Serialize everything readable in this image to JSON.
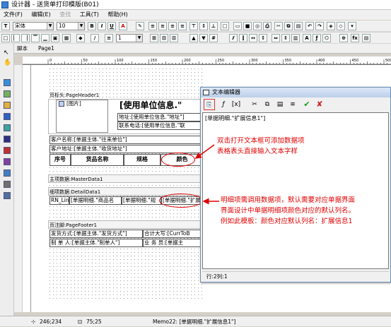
{
  "window": {
    "title": "设计器 - 送货单打印模版(B01)"
  },
  "menu": [
    "文件(F)",
    "编辑(E)",
    "查找",
    "工具(T)",
    "帮助(H)"
  ],
  "toolbar": {
    "font_name": "宋体",
    "font_size": "10",
    "line_width": "1",
    "bold": "B",
    "italic": "I",
    "underline": "U",
    "font_color": "A"
  },
  "tabs": {
    "script": "脚本",
    "page": "Page1"
  },
  "ruler_labels": [
    "0",
    "50",
    "100",
    "150",
    "200",
    "250",
    "300",
    "350",
    "400",
    "450",
    "500",
    "550",
    "600",
    "650",
    "700",
    "750"
  ],
  "report": {
    "page_header_label": "页标头:PageHeader1",
    "image_label": "[图片]",
    "title_field": "[使用单位信息.\"",
    "address_field": "地址:[使用单位信息.\"地址\"]",
    "phone_field": "联系电话:[使用单位信息.\"联",
    "customer_name": "客户名称:[单据主体.\"往来单位\"]",
    "customer_address": "客户地址:[单据主体.\"收货地址\"]",
    "table_headers": [
      "序号",
      "货品名称",
      "规格",
      "颜色"
    ],
    "master_label": "主项数据:MasterData1",
    "detail_label": "细项数据:DetailData1",
    "detail_fields": [
      "RN_Lin",
      "[单据明细.\"商品名",
      "[单据明细.\"规",
      "[单据明细.\"扩展信"
    ],
    "footer_label": "页注脚:PageFooter1",
    "footer_fields": [
      "发货方式:[单据主体.\"发货方式\"]",
      "合计大写:[CurrToB",
      "制 单 人:[单据主体.\"制单人\"]",
      "业 务 员:[单据主"
    ]
  },
  "dialog": {
    "title": "文本编辑器",
    "text": "[单据明细.\"扩展信息1\"]",
    "status": "行:2列:1",
    "ok_icon": "✔",
    "cancel_icon": "✘"
  },
  "annotations": {
    "note1": [
      "双击打开文本框可添加数据项",
      "表格表头直接输入文本字样"
    ],
    "note2": [
      "明细项需调用数据项，默认需要对应单据界面",
      "界面设计中单据明细项颜色对应的默认列名。",
      "例如此模板：颜色对应默认列名：扩展信息1"
    ]
  },
  "statusbar": {
    "pos1": "246;234",
    "pos2": "75;25",
    "memo": "Memo22: [单据明细.\"扩展信息1\"]"
  }
}
